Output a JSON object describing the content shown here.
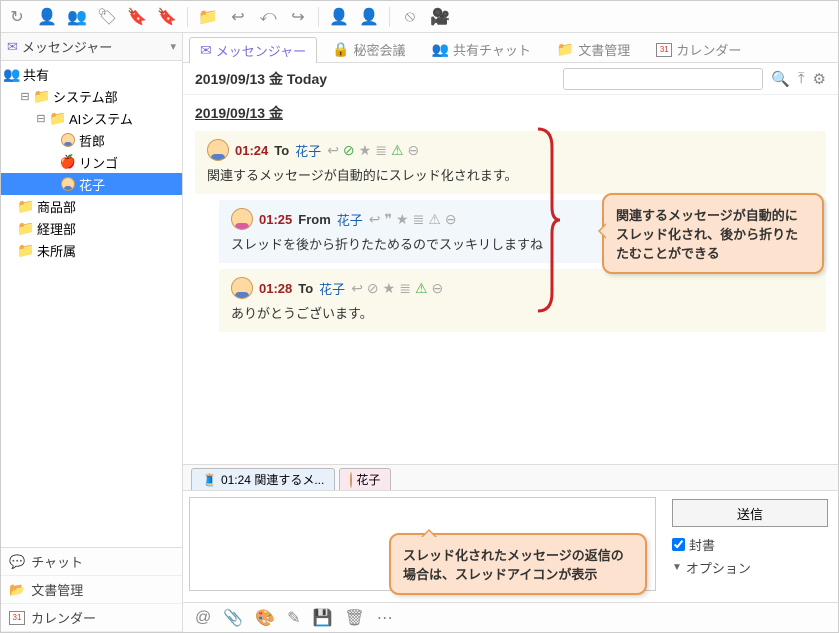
{
  "toolbar_icons": [
    "refresh",
    "user",
    "group",
    "tag",
    "bookmark",
    "bookmark2",
    "sep",
    "folder",
    "reply",
    "reply-all",
    "forward",
    "sep",
    "user-red",
    "user-green",
    "sep",
    "ban",
    "video"
  ],
  "left": {
    "nav_header": {
      "icon": "mail",
      "label": "メッセンジャー"
    },
    "tree": [
      {
        "depth": 0,
        "icon": "group",
        "label": "共有"
      },
      {
        "depth": 1,
        "icon": "folder",
        "exp": "-",
        "label": "システム部"
      },
      {
        "depth": 2,
        "icon": "folder",
        "exp": "-",
        "label": "AIシステム"
      },
      {
        "depth": 3,
        "icon": "avatar-boy",
        "label": "哲郎"
      },
      {
        "depth": 3,
        "icon": "apple",
        "label": "リンゴ"
      },
      {
        "depth": 3,
        "icon": "avatar-girl",
        "label": "花子",
        "selected": true
      },
      {
        "depth": 1,
        "icon": "folder",
        "label": "商品部"
      },
      {
        "depth": 1,
        "icon": "folder",
        "label": "経理部"
      },
      {
        "depth": 1,
        "icon": "folder",
        "label": "未所属"
      }
    ],
    "bottom": [
      {
        "icon": "chat",
        "label": "チャット",
        "color": "#e6b84f"
      },
      {
        "icon": "docs",
        "label": "文書管理",
        "color": "#e6b84f"
      },
      {
        "icon": "cal",
        "label": "カレンダー",
        "color": "#d33",
        "num": "31"
      }
    ]
  },
  "tabs": [
    {
      "icon": "mail",
      "label": "メッセンジャー",
      "active": true,
      "color": "#7a6fd9"
    },
    {
      "icon": "lock",
      "label": "秘密会議",
      "color": "#c9a24a"
    },
    {
      "icon": "people",
      "label": "共有チャット",
      "color": "#5fa85f"
    },
    {
      "icon": "folder",
      "label": "文書管理",
      "color": "#e6b84f"
    },
    {
      "icon": "cal",
      "label": "カレンダー",
      "color": "#d33",
      "num": "31"
    }
  ],
  "date_row": {
    "text": "2019/09/13 金 Today",
    "icons": [
      "search",
      "up",
      "gear"
    ]
  },
  "thread": {
    "date_header": "2019/09/13 金",
    "messages": [
      {
        "kind": "self",
        "indent": 0,
        "avatar": "boy",
        "time": "01:24",
        "dir": "To",
        "who": "花子",
        "actions": [
          "reply",
          "check-green",
          "star",
          "list",
          "warn-green",
          "minus"
        ],
        "body": "関連するメッセージが自動的にスレッド化されます。"
      },
      {
        "kind": "other",
        "indent": 1,
        "avatar": "girl",
        "time": "01:25",
        "dir": "From",
        "who": "花子",
        "actions": [
          "reply",
          "quote",
          "star",
          "list",
          "warn",
          "minus"
        ],
        "body": "スレッドを後から折りたためるのでスッキリしますね"
      },
      {
        "kind": "self",
        "indent": 1,
        "avatar": "boy",
        "time": "01:28",
        "dir": "To",
        "who": "花子",
        "actions": [
          "reply",
          "check",
          "star",
          "list",
          "warn-green",
          "minus"
        ],
        "body": "ありがとうございます。"
      }
    ]
  },
  "callouts": {
    "c1": "関連するメッセージが自動的にスレッド化され、後から折りたたむことができる",
    "c2": "スレッド化されたメッセージの返信の場合は、スレッドアイコンが表示"
  },
  "compose": {
    "tabs": [
      {
        "icon": "thread",
        "label": "01:24 関連するメ...",
        "style": "blue"
      },
      {
        "icon": "avatar-girl",
        "label": "花子",
        "style": "pink"
      }
    ],
    "send_label": "送信",
    "opt_seal": "封書",
    "opt_options": "オプション"
  },
  "bottom_icons": [
    "at",
    "clip",
    "palette",
    "edit",
    "save",
    "trash",
    "more"
  ]
}
